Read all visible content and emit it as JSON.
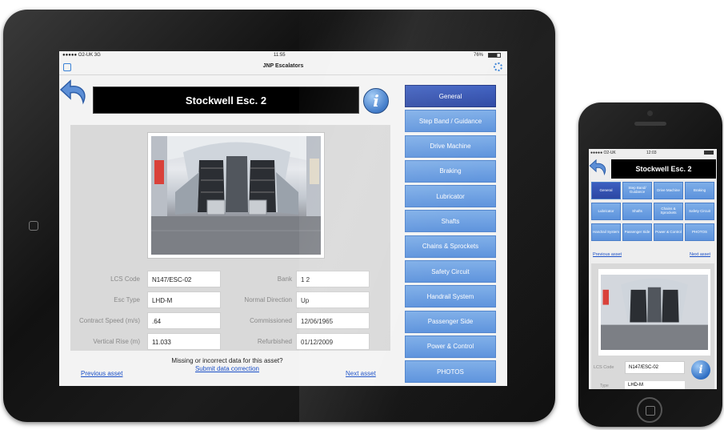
{
  "ipad": {
    "status": {
      "carrier": "●●●●● O2-UK  3G",
      "time": "11:55",
      "battery": "76%"
    },
    "nav_title": "JNP Escalators",
    "asset_title": "Stockwell Esc. 2",
    "info_glyph": "i",
    "photo_caption": "",
    "fields": {
      "lcs_code": {
        "label": "LCS Code",
        "value": "N147/ESC-02"
      },
      "esc_type": {
        "label": "Esc Type",
        "value": "LHD-M"
      },
      "contract_speed": {
        "label": "Contract Speed (m/s)",
        "value": ".64"
      },
      "vertical_rise": {
        "label": "Vertical Rise (m)",
        "value": "11.033"
      },
      "bank": {
        "label": "Bank",
        "value": "1 2"
      },
      "normal_direction": {
        "label": "Normal Direction",
        "value": "Up"
      },
      "commissioned": {
        "label": "Commissioned",
        "value": "12/06/1965"
      },
      "refurbished": {
        "label": "Refurbished",
        "value": "01/12/2009"
      }
    },
    "missing_text": "Missing or incorrect data for this asset?",
    "submit_link": "Submit data correction",
    "previous_link": "Previous asset",
    "next_link": "Next asset",
    "menu": [
      {
        "label": "General",
        "active": true
      },
      {
        "label": "Step Band / Guidance",
        "active": false
      },
      {
        "label": "Drive Machine",
        "active": false
      },
      {
        "label": "Braking",
        "active": false
      },
      {
        "label": "Lubricator",
        "active": false
      },
      {
        "label": "Shafts",
        "active": false
      },
      {
        "label": "Chains & Sprockets",
        "active": false
      },
      {
        "label": "Safety Circuit",
        "active": false
      },
      {
        "label": "Handrail System",
        "active": false
      },
      {
        "label": "Passenger Side",
        "active": false
      },
      {
        "label": "Power & Control",
        "active": false
      },
      {
        "label": "PHOTOS",
        "active": false
      }
    ]
  },
  "iphone": {
    "status": {
      "carrier": "●●●●● O2-UK ",
      "time": "12:03"
    },
    "asset_title": "Stockwell Esc. 2",
    "buttons": [
      {
        "label": "General",
        "active": true
      },
      {
        "label": "Step Band/ Guidance",
        "active": false
      },
      {
        "label": "Drive Machine",
        "active": false
      },
      {
        "label": "Braking",
        "active": false
      },
      {
        "label": "Lubricator",
        "active": false
      },
      {
        "label": "Shafts",
        "active": false
      },
      {
        "label": "Chains & Sprockets",
        "active": false
      },
      {
        "label": "Safety Circuit",
        "active": false
      },
      {
        "label": "Handrail System",
        "active": false
      },
      {
        "label": "Passenger Side",
        "active": false
      },
      {
        "label": "Power & Control",
        "active": false
      },
      {
        "label": "PHOTOS",
        "active": false
      }
    ],
    "previous_link": "Previous asset",
    "next_link": "Next asset",
    "lcs_label": "LCS Code",
    "lcs_value": "N147/ESC-02",
    "type_label": "Type",
    "type_value": "LHD-M",
    "info_glyph": "i"
  },
  "colors": {
    "menu_blue": "#6aa0e2",
    "menu_active": "#34509f",
    "link_blue": "#1a4fc7",
    "title_bg": "#000000"
  }
}
